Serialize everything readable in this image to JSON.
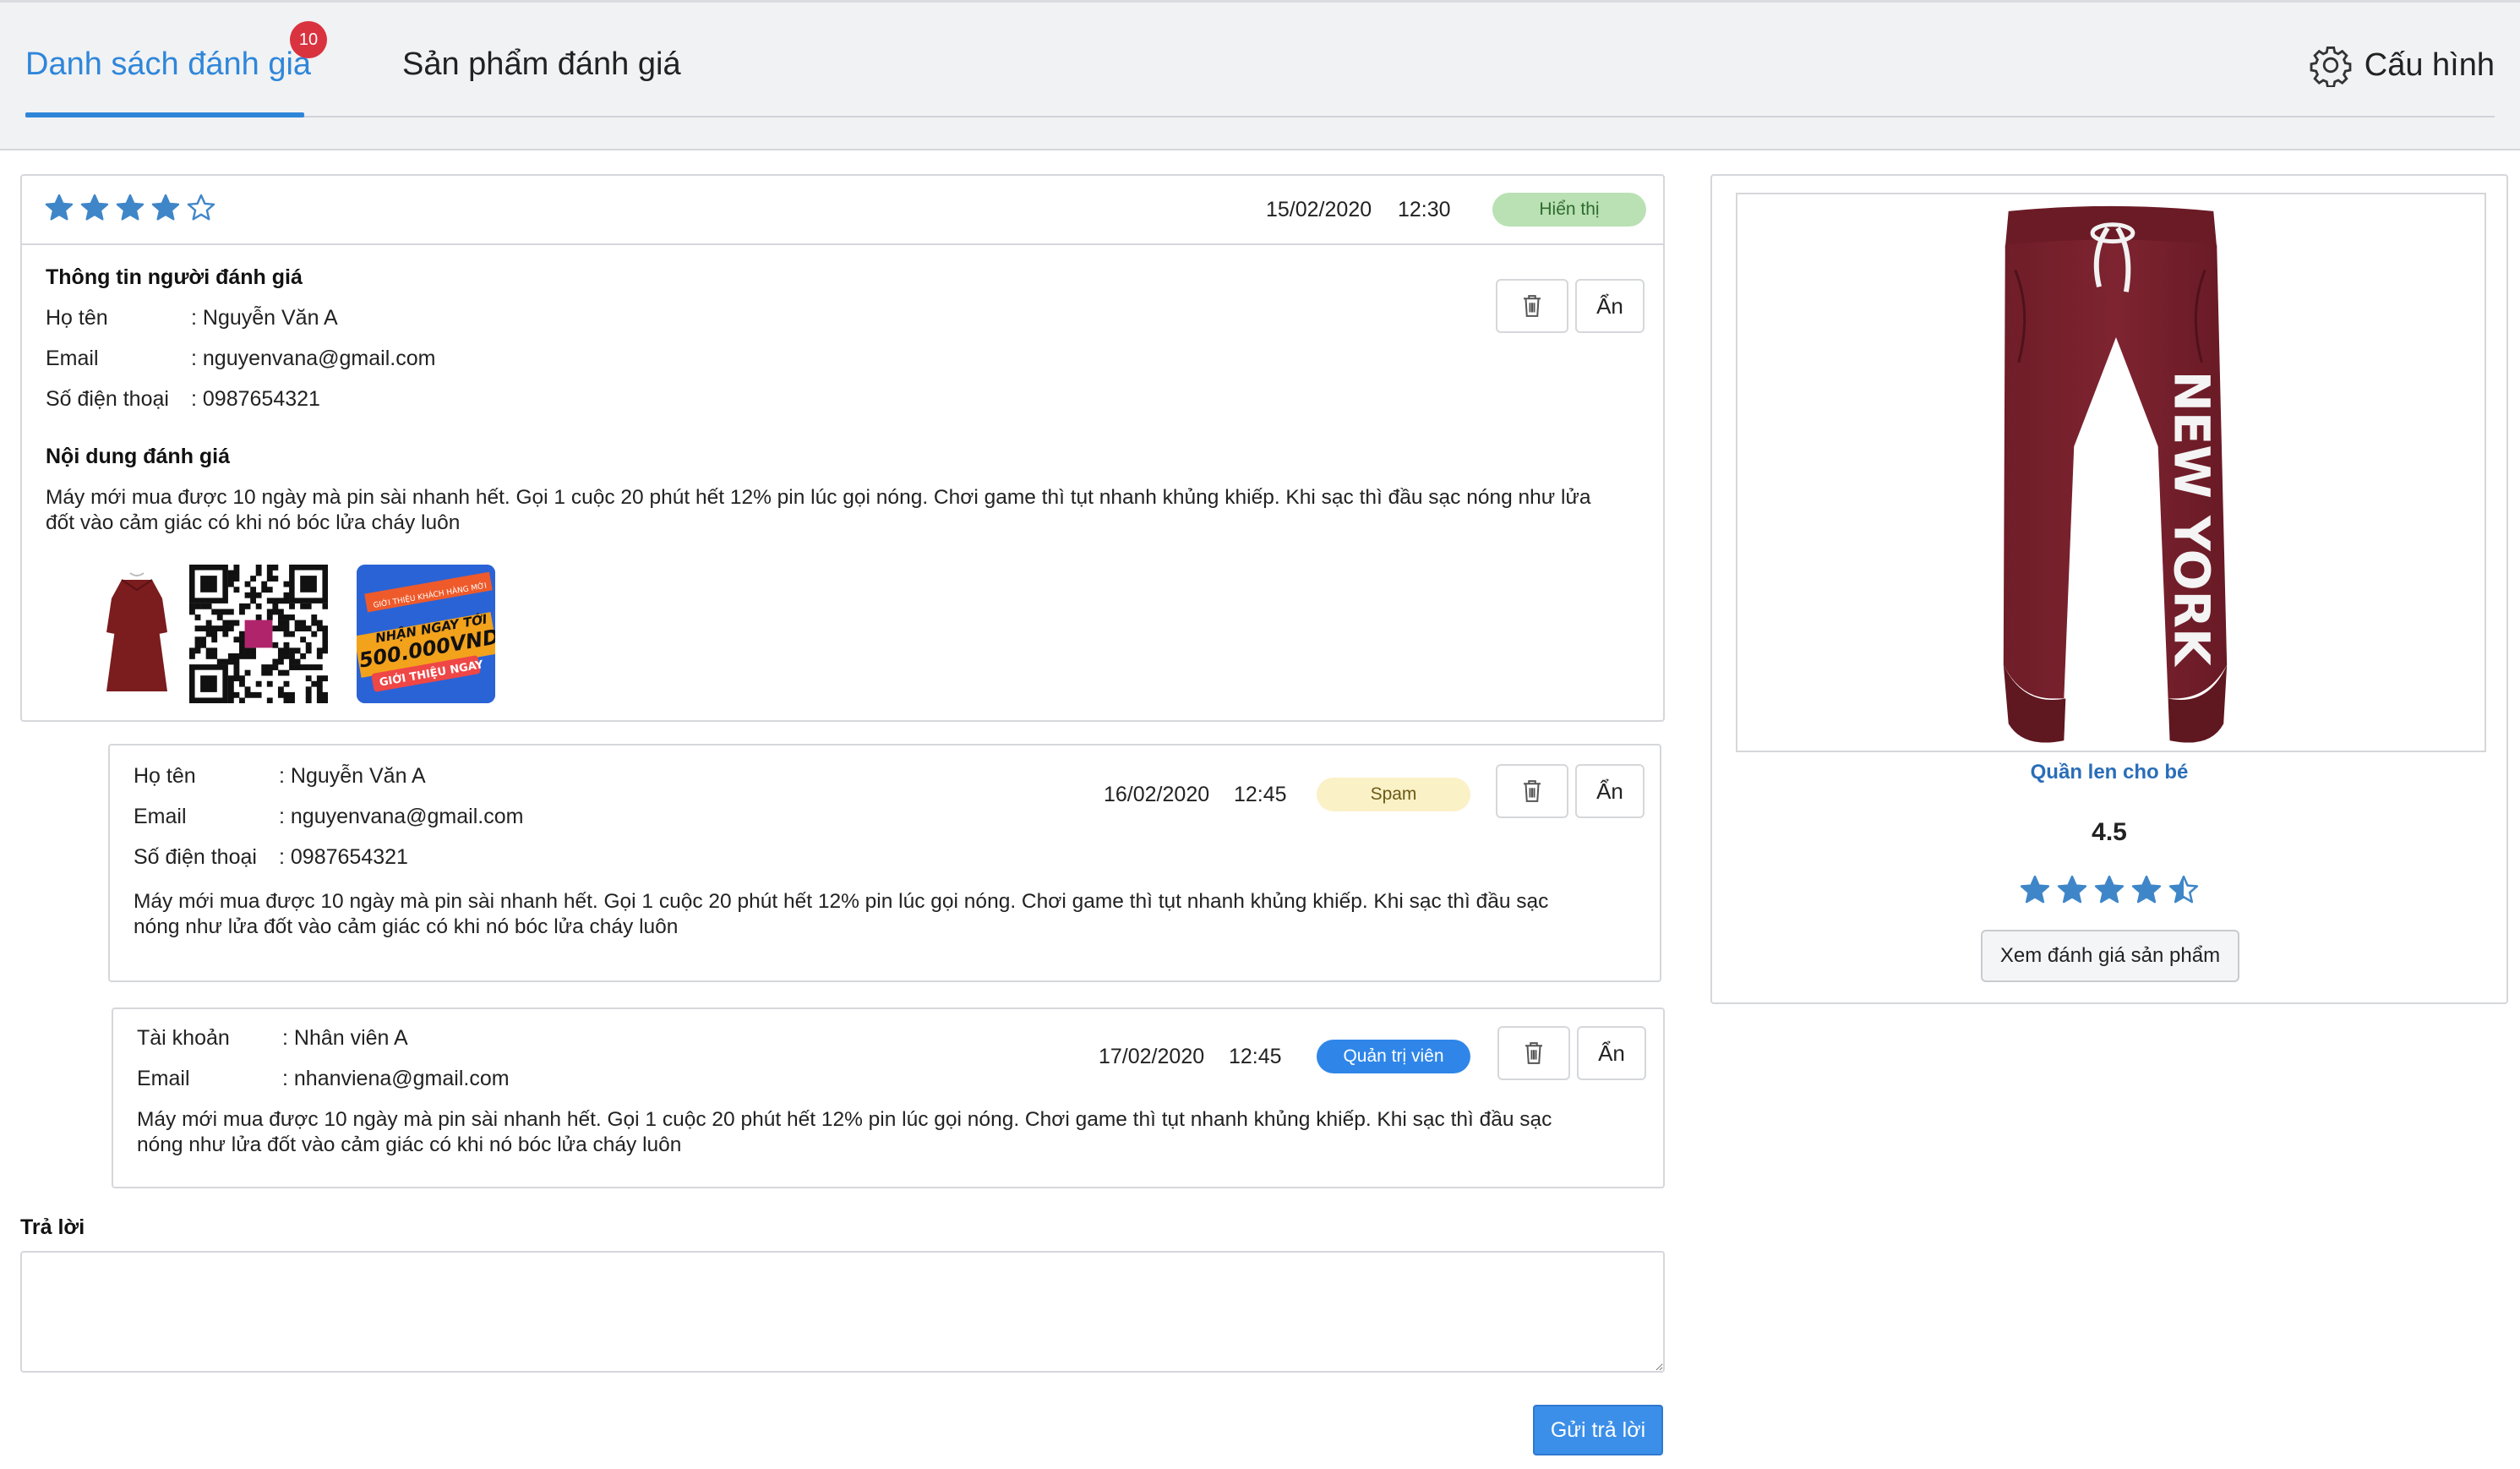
{
  "tabs": {
    "reviews_label": "Danh sách đánh giá",
    "reviews_badge": "10",
    "products_label": "Sản phẩm đánh giá",
    "settings_label": "Cấu hình"
  },
  "review": {
    "rating": 4,
    "max_rating": 5,
    "date": "15/02/2020",
    "time": "12:30",
    "status": "Hiển thị",
    "reviewer_section_title": "Thông tin người đánh giá",
    "name_label": "Họ tên",
    "name_value": ": Nguyễn Văn A",
    "email_label": "Email",
    "email_value": ": nguyenvana@gmail.com",
    "phone_label": "Số điện thoại",
    "phone_value": ": 0987654321",
    "content_title": "Nội dung đánh giá",
    "content_line1": "Máy mới mua được 10 ngày mà pin sài nhanh hết. Gọi 1 cuộc 20 phút hết 12% pin lúc gọi nóng. Chơi game thì tụt nhanh khủng khiếp. Khi sạc thì đầu sạc nóng như lửa",
    "content_line2": "đốt vào cảm giác có khi nó bóc lửa cháy luôn",
    "hide_label": "Ẩn",
    "attachments": [
      "dress-thumbnail",
      "qr-code-thumbnail",
      "promo-banner-thumbnail"
    ],
    "promo_text": {
      "line1": "GIỚI THIỆU KHÁCH HÀNG MỚI",
      "line2": "NHẬN NGAY TỚI",
      "line3": "500.000VND",
      "line4": "GIỚI THIỆU NGAY"
    }
  },
  "replies": [
    {
      "name_label": "Họ tên",
      "name_value": ": Nguyễn Văn A",
      "email_label": "Email",
      "email_value": ": nguyenvana@gmail.com",
      "phone_label": "Số điện thoại",
      "phone_value": ": 0987654321",
      "date": "16/02/2020",
      "time": "12:45",
      "status": "Spam",
      "content_line1": "Máy mới mua được 10 ngày mà pin sài nhanh hết. Gọi 1 cuộc 20 phút hết 12% pin lúc gọi nóng. Chơi game thì tụt nhanh khủng khiếp. Khi sạc thì đầu sạc",
      "content_line2": "nóng như lửa đốt vào cảm giác có khi nó bóc lửa cháy luôn",
      "hide_label": "Ẩn"
    },
    {
      "account_label": "Tài khoản",
      "account_value": ": Nhân viên A",
      "email_label": "Email",
      "email_value": ": nhanviena@gmail.com",
      "date": "17/02/2020",
      "time": "12:45",
      "status": "Quản trị viên",
      "content_line1": "Máy mới mua được 10 ngày mà pin sài nhanh hết. Gọi 1 cuộc 20 phút hết 12% pin lúc gọi nóng. Chơi game thì tụt nhanh khủng khiếp. Khi sạc thì đầu sạc",
      "content_line2": "nóng như lửa đốt vào cảm giác có khi nó bóc lửa cháy luôn",
      "hide_label": "Ẩn"
    }
  ],
  "answer": {
    "label": "Trả lời",
    "placeholder": "",
    "send_label": "Gửi trả lời"
  },
  "product": {
    "name": "Quần len cho bé",
    "score": "4.5",
    "rating": 4.5,
    "print_text": "NEW YORK",
    "view_button_label": "Xem đánh giá sản phẩm"
  },
  "colors": {
    "accent": "#2f86d9",
    "star": "#3f86c8",
    "badge": "#d9333f",
    "visible_status": "#b9e1b3",
    "spam_status": "#fbf1c7",
    "admin_status": "#2f86e8"
  }
}
